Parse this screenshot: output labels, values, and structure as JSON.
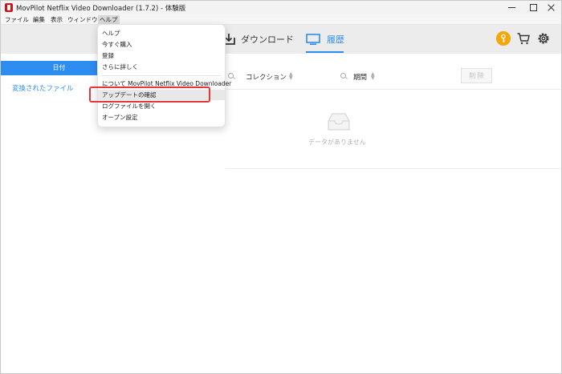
{
  "window": {
    "title": "MovPilot Netflix Video Downloader (1.7.2) - 体験版"
  },
  "menubar": {
    "items": [
      "ファイル",
      "編集",
      "表示",
      "ウィンドウ",
      "ヘルプ"
    ]
  },
  "toolbar": {
    "download_label": "ダウンロード",
    "history_label": "履歴",
    "accent_color": "#2d8cf0"
  },
  "sidebar": {
    "tab_label": "日付",
    "item_label": "変換されたファイル"
  },
  "table": {
    "columns": [
      "コレクション",
      "期間"
    ],
    "delete_label": "削 除"
  },
  "empty_state": {
    "message": "データがありません"
  },
  "help_menu": {
    "items": [
      "ヘルプ",
      "今すぐ購入",
      "登録",
      "さらに詳しく",
      "について MovPilot Netflix Video Downloader",
      "アップデートの確認",
      "ログファイルを開く",
      "オープン設定"
    ],
    "highlighted_item": "アップデートの確認",
    "highlight_color": "#e8353a"
  }
}
